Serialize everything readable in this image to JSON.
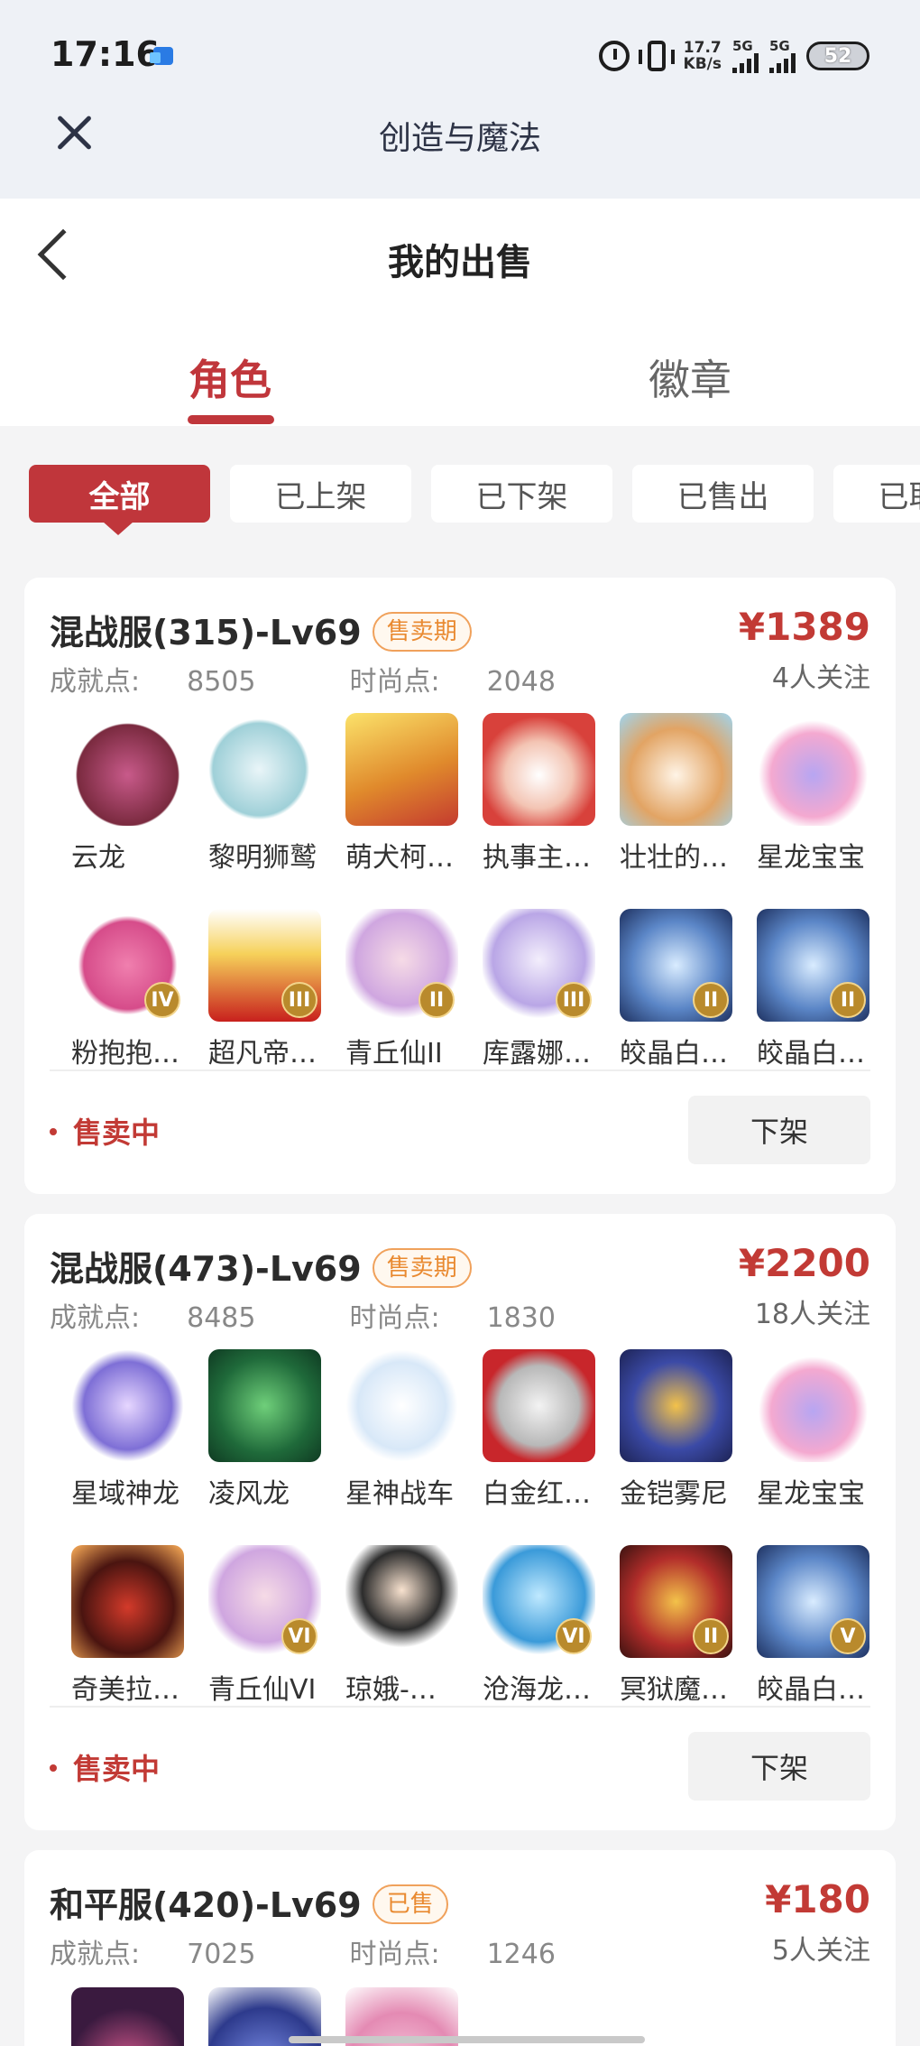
{
  "status_bar": {
    "time": "17:16",
    "speed_value": "17.7",
    "speed_unit": "KB/s",
    "sig1": "5G",
    "sig2": "5G",
    "battery": "52"
  },
  "app_bar": {
    "title": "创造与魔法"
  },
  "page": {
    "title": "我的出售"
  },
  "tabs": [
    {
      "label": "角色"
    },
    {
      "label": "徽章"
    }
  ],
  "filters": [
    {
      "label": "全部"
    },
    {
      "label": "已上架"
    },
    {
      "label": "已下架"
    },
    {
      "label": "已售出"
    },
    {
      "label": "已取消"
    }
  ],
  "labels": {
    "achievement": "成就点:",
    "fashion": "时尚点:"
  },
  "colors": {
    "accent": "#c0363b",
    "price": "#c23a35",
    "badge": "#e98a31"
  },
  "listings": [
    {
      "server": "混战服(315)-Lv69",
      "badge": "售卖期",
      "price": "¥1389",
      "achievement": "8505",
      "fashion": "2048",
      "watchers": "4人关注",
      "status": "售卖中",
      "action": "下架",
      "items": [
        {
          "name": "云龙",
          "tier": ""
        },
        {
          "name": "黎明狮鹫",
          "tier": ""
        },
        {
          "name": "萌犬柯…",
          "tier": ""
        },
        {
          "name": "执事主…",
          "tier": ""
        },
        {
          "name": "壮壮的…",
          "tier": ""
        },
        {
          "name": "星龙宝宝",
          "tier": ""
        },
        {
          "name": "粉抱抱…",
          "tier": "IV"
        },
        {
          "name": "超凡帝…",
          "tier": "III"
        },
        {
          "name": "青丘仙II",
          "tier": "II"
        },
        {
          "name": "库露娜…",
          "tier": "III"
        },
        {
          "name": "皎晶白…",
          "tier": "II"
        },
        {
          "name": "皎晶白…",
          "tier": "II"
        }
      ]
    },
    {
      "server": "混战服(473)-Lv69",
      "badge": "售卖期",
      "price": "¥2200",
      "achievement": "8485",
      "fashion": "1830",
      "watchers": "18人关注",
      "status": "售卖中",
      "action": "下架",
      "items": [
        {
          "name": "星域神龙",
          "tier": ""
        },
        {
          "name": "凌风龙",
          "tier": ""
        },
        {
          "name": "星神战车",
          "tier": ""
        },
        {
          "name": "白金红…",
          "tier": ""
        },
        {
          "name": "金铠雾尼",
          "tier": ""
        },
        {
          "name": "星龙宝宝",
          "tier": ""
        },
        {
          "name": "奇美拉…",
          "tier": ""
        },
        {
          "name": "青丘仙VI",
          "tier": "VI"
        },
        {
          "name": "琼娥-…",
          "tier": ""
        },
        {
          "name": "沧海龙…",
          "tier": "VI"
        },
        {
          "name": "冥狱魔…",
          "tier": "II"
        },
        {
          "name": "皎晶白…",
          "tier": "V"
        }
      ]
    },
    {
      "server": "和平服(420)-Lv69",
      "badge": "已售",
      "price": "¥180",
      "achievement": "7025",
      "fashion": "1246",
      "watchers": "5人关注",
      "items": [
        {
          "name": "",
          "tier": ""
        },
        {
          "name": "",
          "tier": ""
        },
        {
          "name": "",
          "tier": ""
        }
      ]
    }
  ]
}
